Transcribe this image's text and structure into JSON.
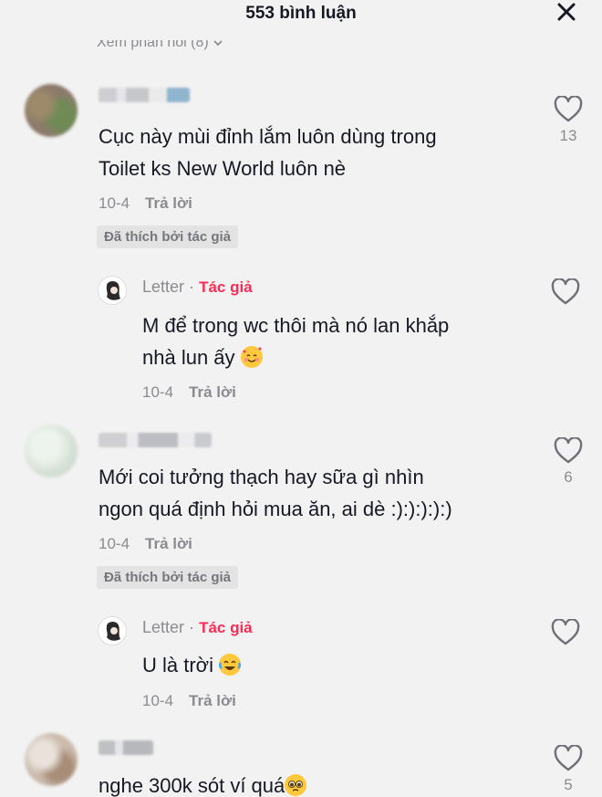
{
  "header": {
    "title": "553 bình luận"
  },
  "view_replies": "Xem phản hồi (8)",
  "comments": [
    {
      "text_l1": "Cục này mùi đỉnh lắm luôn dùng trong",
      "text_l2": "Toilet ks New World luôn nè",
      "date": "10-4",
      "reply": "Trả lời",
      "badge": "Đã thích bởi tác giả",
      "likes": "13"
    },
    {
      "username": "Letter",
      "dot": "·",
      "tag": "Tác giả",
      "text_l1": "M để trong wc thôi mà nó lan khắp",
      "text_l2": "nhà lun ấy",
      "emoji": "smiling-face-with-hearts",
      "date": "10-4",
      "reply": "Trả lời"
    },
    {
      "text_l1": "Mới coi tưởng thạch hay sữa gì nhìn",
      "text_l2": "ngon quá định hỏi mua ăn, ai dè :):):):):)",
      "date": "10-4",
      "reply": "Trả lời",
      "badge": "Đã thích bởi tác giả",
      "likes": "6"
    },
    {
      "username": "Letter",
      "dot": "·",
      "tag": "Tác giả",
      "text_l1": "U là trời",
      "emoji": "face-with-tears-of-joy",
      "date": "10-4",
      "reply": "Trả lời"
    },
    {
      "text_l1": "nghe 300k sót ví quá",
      "emoji": "pleading-face",
      "likes": "5"
    }
  ],
  "colors": {
    "author_tag": "#fe2c55",
    "muted": "#8a8b91",
    "background": "#f2f2f2"
  }
}
